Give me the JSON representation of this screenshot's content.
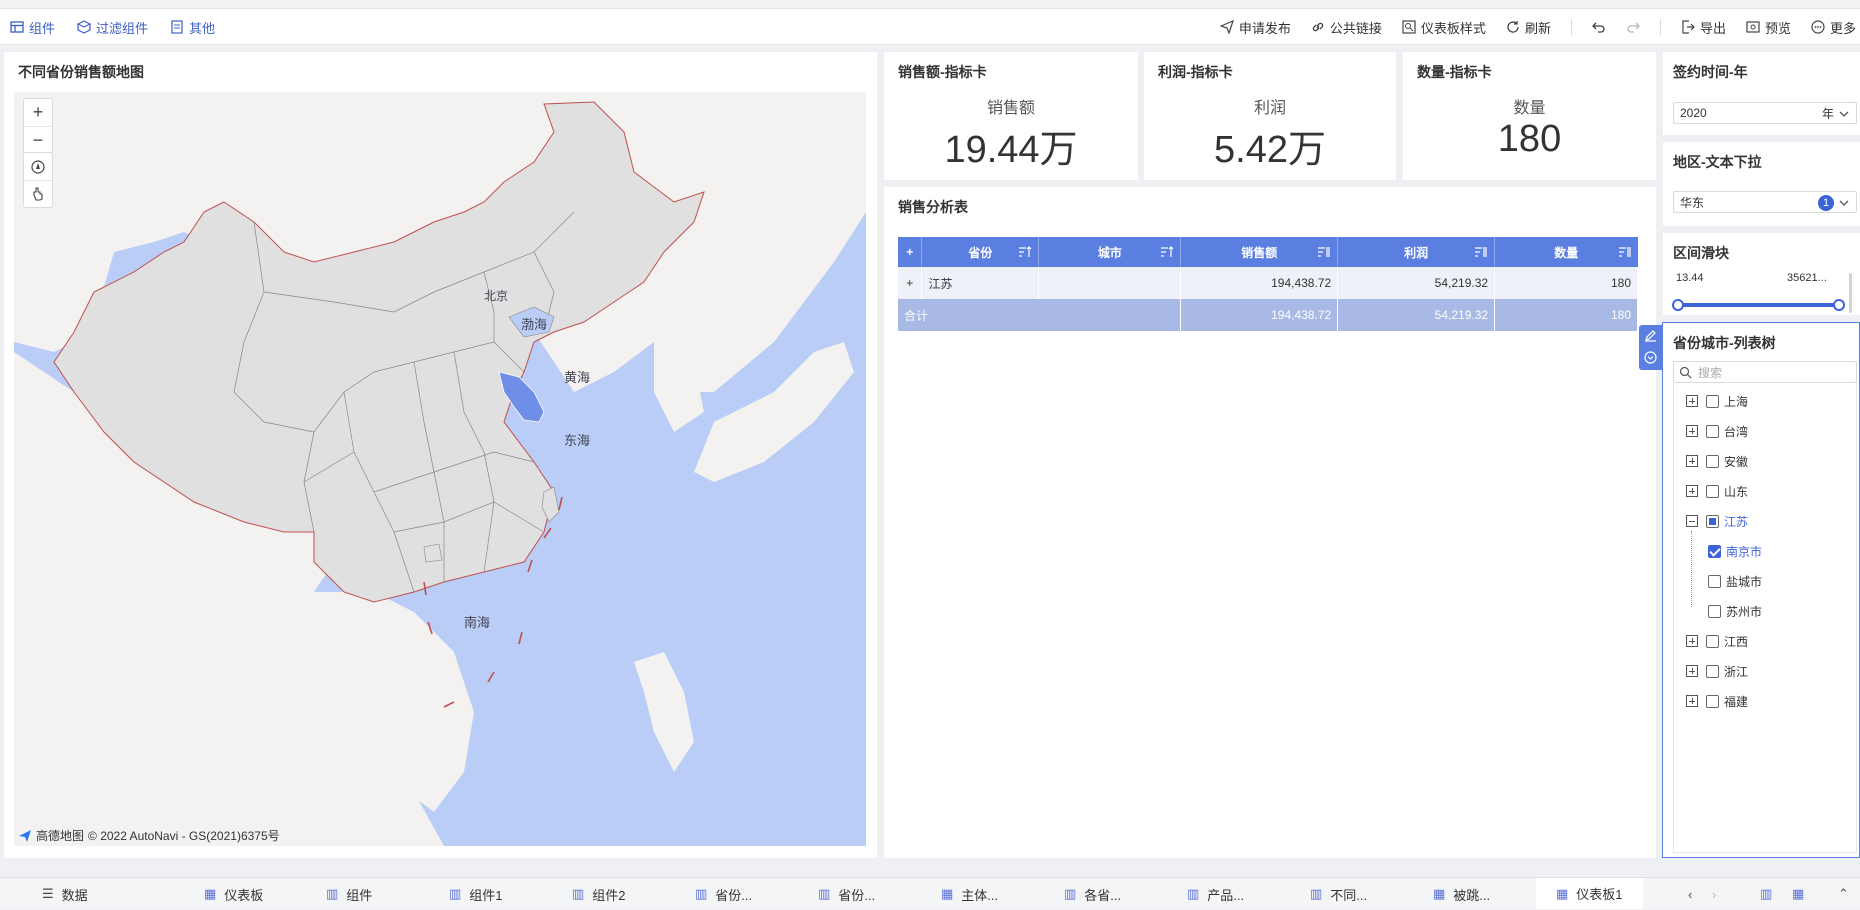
{
  "toolbar": {
    "left": [
      {
        "label": "组件",
        "icon": "component-icon"
      },
      {
        "label": "过滤组件",
        "icon": "filter-component-icon"
      },
      {
        "label": "其他",
        "icon": "other-icon"
      }
    ],
    "right": [
      {
        "label": "申请发布",
        "icon": "send-icon"
      },
      {
        "label": "公共链接",
        "icon": "link-icon"
      },
      {
        "label": "仪表板样式",
        "icon": "style-icon"
      },
      {
        "label": "刷新",
        "icon": "refresh-icon"
      },
      {
        "label": "导出",
        "icon": "export-icon"
      },
      {
        "label": "预览",
        "icon": "preview-icon"
      },
      {
        "label": "更多",
        "icon": "more-icon"
      }
    ]
  },
  "map": {
    "title": "不同省份销售额地图",
    "labels": {
      "beijing": "北京",
      "bohai": "渤海",
      "huanghai": "黄海",
      "donghai": "东海",
      "nanhai": "南海"
    },
    "credit_brand": "高德地图",
    "credit_text": "© 2022 AutoNavi - GS(2021)6375号",
    "colors": {
      "sea": "#b9cdf7",
      "land": "#e0e0e0",
      "highlight": "#6e8ee8"
    }
  },
  "kpis": [
    {
      "title": "销售额-指标卡",
      "label": "销售额",
      "value": "19.44万"
    },
    {
      "title": "利润-指标卡",
      "label": "利润",
      "value": "5.42万"
    },
    {
      "title": "数量-指标卡",
      "label": "数量",
      "value": "180"
    }
  ],
  "table": {
    "title": "销售分析表",
    "headers": [
      "省份",
      "城市",
      "销售额",
      "利润",
      "数量"
    ],
    "row": {
      "expand": "+",
      "province": "江苏",
      "city": "",
      "sales": "194,438.72",
      "profit": "54,219.32",
      "qty": "180"
    },
    "total": {
      "label": "合计",
      "sales": "194,438.72",
      "profit": "54,219.32",
      "qty": "180"
    }
  },
  "filters": {
    "year": {
      "title": "签约时间-年",
      "value": "2020",
      "unit": "年"
    },
    "region": {
      "title": "地区-文本下拉",
      "value": "华东",
      "count": "1"
    },
    "range": {
      "title": "区间滑块",
      "min": "13.44",
      "max": "35621..."
    },
    "tree": {
      "title": "省份城市-列表树",
      "search_placeholder": "搜索",
      "items": [
        {
          "label": "上海",
          "state": "collapsed"
        },
        {
          "label": "台湾",
          "state": "collapsed"
        },
        {
          "label": "安徽",
          "state": "collapsed"
        },
        {
          "label": "山东",
          "state": "collapsed"
        },
        {
          "label": "江苏",
          "state": "expanded"
        },
        {
          "label": "南京市",
          "state": "checked"
        },
        {
          "label": "盐城市",
          "state": "unchecked"
        },
        {
          "label": "苏州市",
          "state": "unchecked"
        },
        {
          "label": "江西",
          "state": "collapsed"
        },
        {
          "label": "浙江",
          "state": "collapsed"
        },
        {
          "label": "福建",
          "state": "collapsed"
        }
      ]
    }
  },
  "tabs": [
    "数据",
    "仪表板",
    "组件",
    "组件1",
    "组件2",
    "省份...",
    "省份...",
    "主体...",
    "各省...",
    "产品...",
    "不同...",
    "被跳...",
    "仪表板1"
  ]
}
